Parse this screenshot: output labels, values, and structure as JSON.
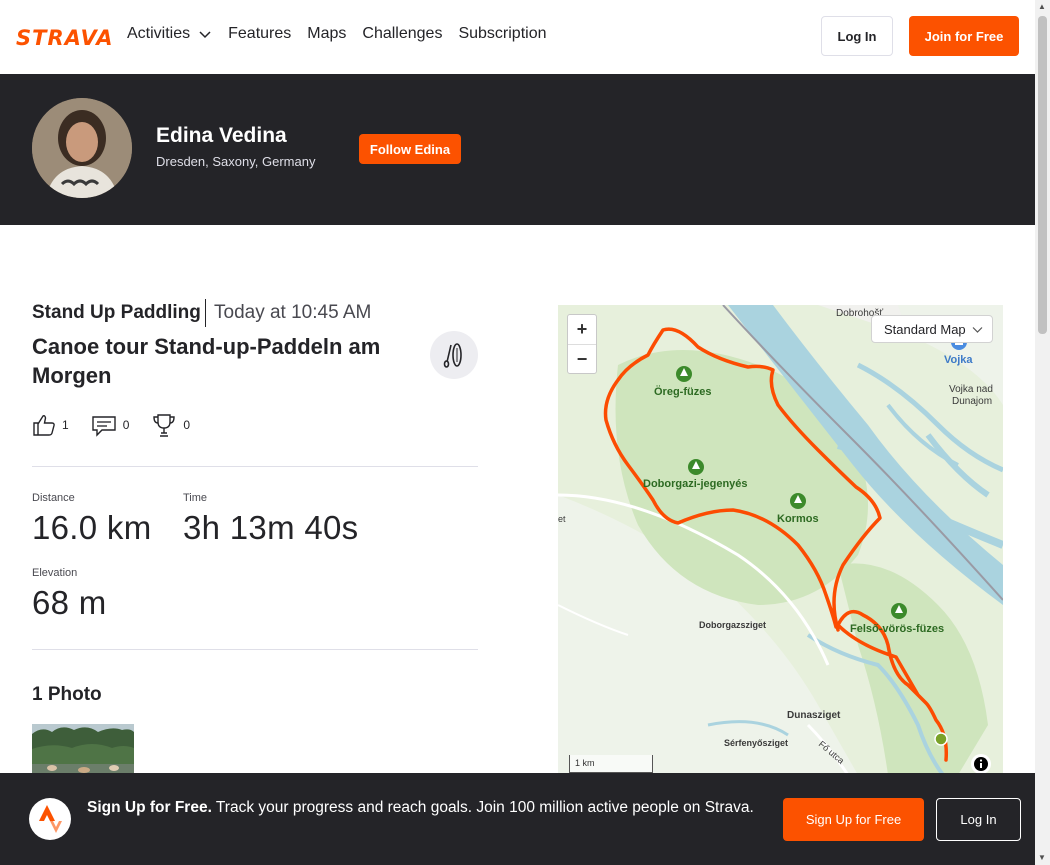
{
  "nav": {
    "logo": "STRAVA",
    "links": [
      "Activities",
      "Features",
      "Maps",
      "Challenges",
      "Subscription"
    ],
    "login": "Log In",
    "join": "Join for Free"
  },
  "athlete": {
    "name": "Edina Vedina",
    "location": "Dresden, Saxony, Germany",
    "follow": "Follow Edina"
  },
  "activity": {
    "type": "Stand Up Paddling",
    "time": "Today at 10:45 AM",
    "title": "Canoe tour Stand-up-Paddeln am Morgen",
    "kudos": "1",
    "comments": "0",
    "achievements": "0",
    "stats": {
      "distance_label": "Distance",
      "distance_value": "16.0 km",
      "time_label": "Time",
      "time_value": "3h 13m 40s",
      "elevation_label": "Elevation",
      "elevation_value": "68 m"
    },
    "photos_heading": "1 Photo"
  },
  "map": {
    "style_select": "Standard Map",
    "zoom_in": "+",
    "zoom_out": "−",
    "scale": "1 km",
    "labels": {
      "dobrohost": "Dobrohošť",
      "vojka": "Vojka",
      "vojka_nad": "Vojka nad",
      "dunajom": "Dunajom",
      "oreg": "Öreg-füzes",
      "doborgazi_j": "Doborgazi-jegenyés",
      "kormos": "Kormos",
      "felso": "Felső-vörös-füzes",
      "doborgazsziget": "Doborgazsziget",
      "dunasziget": "Dunasziget",
      "serfenyosziget": "Sérfenyősziget",
      "fo_utca": "Fő utca",
      "et": "et"
    },
    "colors": {
      "route": "#fc4c02",
      "water": "#aad3df",
      "land": "#e7f0dc"
    }
  },
  "banner": {
    "bold": "Sign Up for Free.",
    "text": " Track your progress and reach goals. Join 100 million active people on Strava.",
    "signup": "Sign Up for Free",
    "login": "Log In"
  },
  "colors": {
    "brand": "#fc5200",
    "dark": "#242428"
  }
}
